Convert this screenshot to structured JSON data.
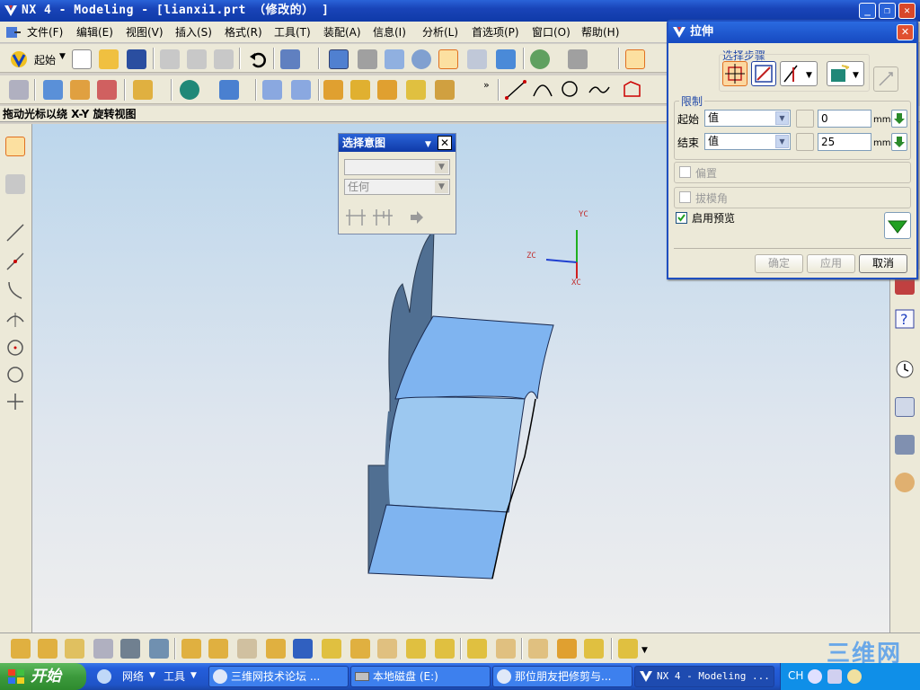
{
  "window": {
    "title": "NX 4 - Modeling - [lianxi1.prt （修改的） ]"
  },
  "menubar": {
    "items": [
      "文件(F)",
      "编辑(E)",
      "视图(V)",
      "插入(S)",
      "格式(R)",
      "工具(T)",
      "装配(A)",
      "信息(I)",
      "分析(L)",
      "首选项(P)",
      "窗口(O)",
      "帮助(H)"
    ]
  },
  "toolbar": {
    "start_label": "起始"
  },
  "cue_line": "拖动光标以绕 X-Y 旋转视图",
  "select_intent": {
    "title": "选择意图",
    "dropdown1": "",
    "dropdown2": "任何"
  },
  "triad": {
    "yc": "YC",
    "zc": "ZC",
    "xc": "XC"
  },
  "extrude": {
    "title": "拉伸",
    "selection_steps_label": "选择步骤",
    "limits_label": "限制",
    "start_label": "起始",
    "start_type": "值",
    "start_value": "0",
    "end_label": "结束",
    "end_type": "值",
    "end_value": "25",
    "unit": "mm",
    "offset_label": "偏置",
    "draft_label": "拔模角",
    "preview_label": "启用预览",
    "ok_label": "确定",
    "apply_label": "应用",
    "cancel_label": "取消"
  },
  "taskbar": {
    "start": "开始",
    "quick1": "网络",
    "quick2": "工具",
    "tasks": [
      "三维网技术论坛 ...",
      "本地磁盘 (E:)",
      "那位朋友把修剪与...",
      "NX 4 - Modeling ..."
    ],
    "tray_lang": "CH"
  },
  "watermark": "三维网",
  "colors": {
    "titlebar": "#1944b8",
    "part_face": "#7fb4f0",
    "part_side": "#5a7ba0",
    "viewport_top": "#bcd6ec"
  }
}
